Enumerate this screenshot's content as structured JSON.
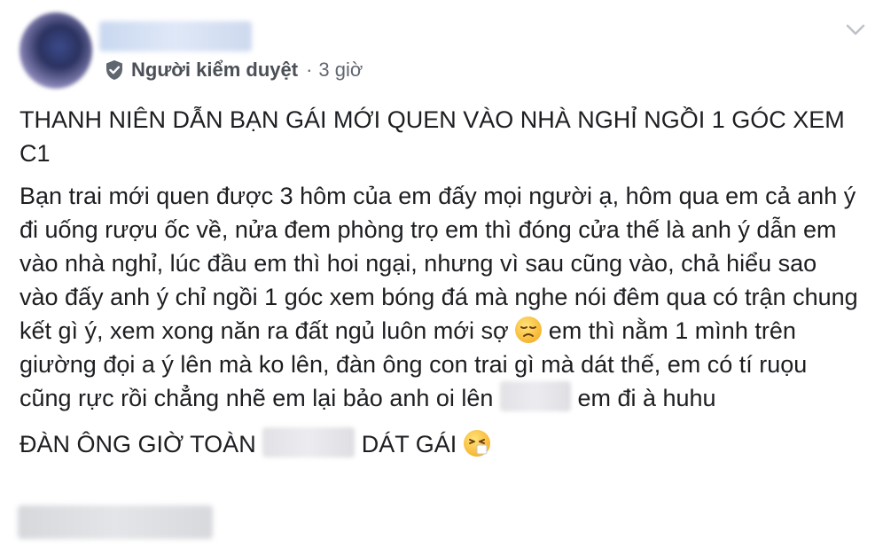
{
  "header": {
    "role_label": "Người kiểm duyệt",
    "separator": "·",
    "time": "3 giờ"
  },
  "post": {
    "title": "THANH NIÊN DẪN BẠN GÁI MỚI QUEN VÀO NHÀ NGHỈ NGỒI 1 GÓC XEM C1",
    "body_part1": "Bạn trai mới quen được 3 hôm của em đấy mọi người ạ, hôm qua em cả anh ý đi uống rượu ốc về, nửa đem phòng trọ em thì đóng cửa thế là anh ý dẫn em vào nhà nghỉ, lúc đầu em thì hoi ngại, nhưng vì sau cũng vào, chả hiểu sao vào đấy anh ý chỉ ngồi 1 góc xem bóng đá mà nghe nói đêm qua có trận chung kết gì ý, xem xong năn ra đất ngủ luôn mới sợ",
    "body_part2": "em thì nằm 1 mình trên giường đọi a ý lên mà ko lên, đàn ông con trai gì mà dát thế, em có tí ruọu cũng rực rồi chẳng nhẽ em lại bảo anh oi lên",
    "body_part3": "em đi à huhu",
    "closing_part1": "ĐÀN ÔNG GIỜ TOÀN",
    "closing_part2": "DÁT GÁI"
  },
  "icons": {
    "badge": "shield-check-icon",
    "menu": "chevron-down-icon",
    "emoji_sad": "disappointed-face-emoji",
    "emoji_sneeze": "sneezing-face-emoji"
  },
  "colors": {
    "text": "#1c1e21",
    "meta": "#606770",
    "emoji": "#f7b733"
  }
}
